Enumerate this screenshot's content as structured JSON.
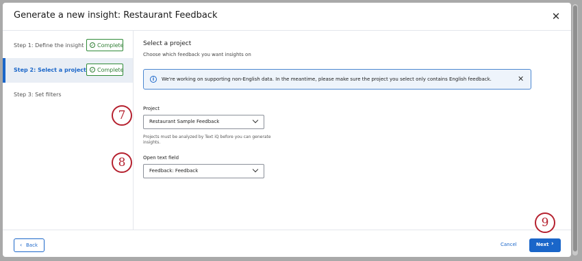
{
  "dialog": {
    "title": "Generate a new insight: Restaurant Feedback",
    "close_icon": "close-icon"
  },
  "steps": [
    {
      "label": "Step 1: Define the insight",
      "badge": "Complete",
      "active": false
    },
    {
      "label": "Step 2: Select a project",
      "badge": "Complete",
      "active": true
    },
    {
      "label": "Step 3: Set filters",
      "badge": "",
      "active": false
    }
  ],
  "main": {
    "section_title": "Select a project",
    "section_subtitle": "Choose which feedback you want insights on",
    "notice": "We're working on supporting non-English data. In the meantime, please make sure the project you select only contains English feedback.",
    "project_label": "Project",
    "project_value": "Restaurant Sample Feedback",
    "project_help": "Projects must be analyzed by Text iQ before you can generate insights.",
    "open_text_label": "Open text field",
    "open_text_value": "Feedback: Feedback"
  },
  "callouts": [
    "7",
    "8",
    "9"
  ],
  "footer": {
    "back_label": "Back",
    "cancel_label": "Cancel",
    "next_label": "Next"
  },
  "colors": {
    "accent": "#1a66c9",
    "complete": "#2e7d32",
    "callout": "#b5202e"
  }
}
